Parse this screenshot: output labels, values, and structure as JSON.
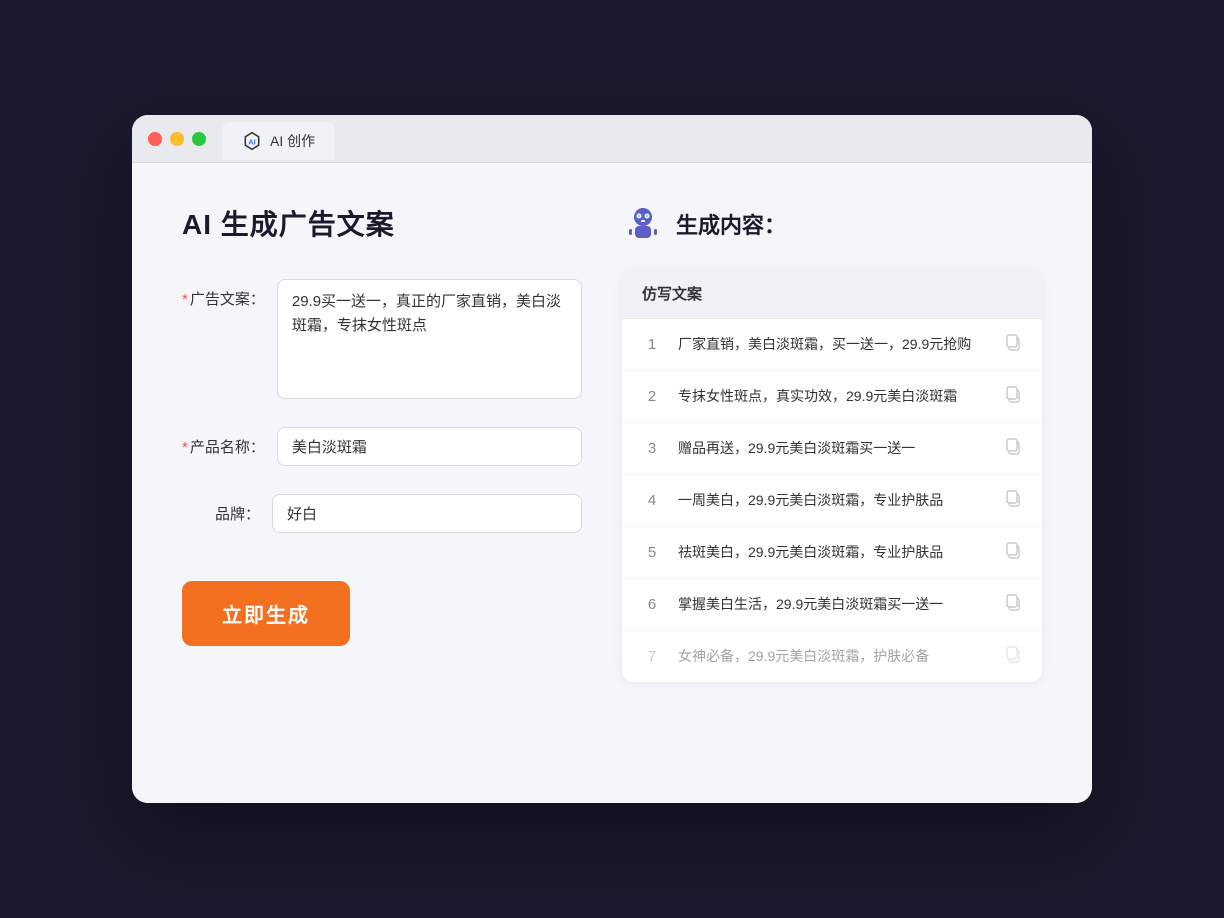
{
  "window": {
    "tab_label": "AI 创作"
  },
  "page": {
    "title": "AI 生成广告文案"
  },
  "form": {
    "ad_copy_label": "广告文案：",
    "ad_copy_required": "*",
    "ad_copy_value": "29.9买一送一，真正的厂家直销，美白淡斑霜，专抹女性斑点",
    "product_name_label": "产品名称：",
    "product_name_required": "*",
    "product_name_value": "美白淡斑霜",
    "brand_label": "品牌：",
    "brand_value": "好白",
    "generate_button": "立即生成"
  },
  "result": {
    "title": "生成内容：",
    "column_header": "仿写文案",
    "items": [
      {
        "id": 1,
        "text": "厂家直销，美白淡斑霜，买一送一，29.9元抢购",
        "muted": false
      },
      {
        "id": 2,
        "text": "专抹女性斑点，真实功效，29.9元美白淡斑霜",
        "muted": false
      },
      {
        "id": 3,
        "text": "赠品再送，29.9元美白淡斑霜买一送一",
        "muted": false
      },
      {
        "id": 4,
        "text": "一周美白，29.9元美白淡斑霜，专业护肤品",
        "muted": false
      },
      {
        "id": 5,
        "text": "祛斑美白，29.9元美白淡斑霜，专业护肤品",
        "muted": false
      },
      {
        "id": 6,
        "text": "掌握美白生活，29.9元美白淡斑霜买一送一",
        "muted": false
      },
      {
        "id": 7,
        "text": "女神必备，29.9元美白淡斑霜，护肤必备",
        "muted": true
      }
    ]
  }
}
